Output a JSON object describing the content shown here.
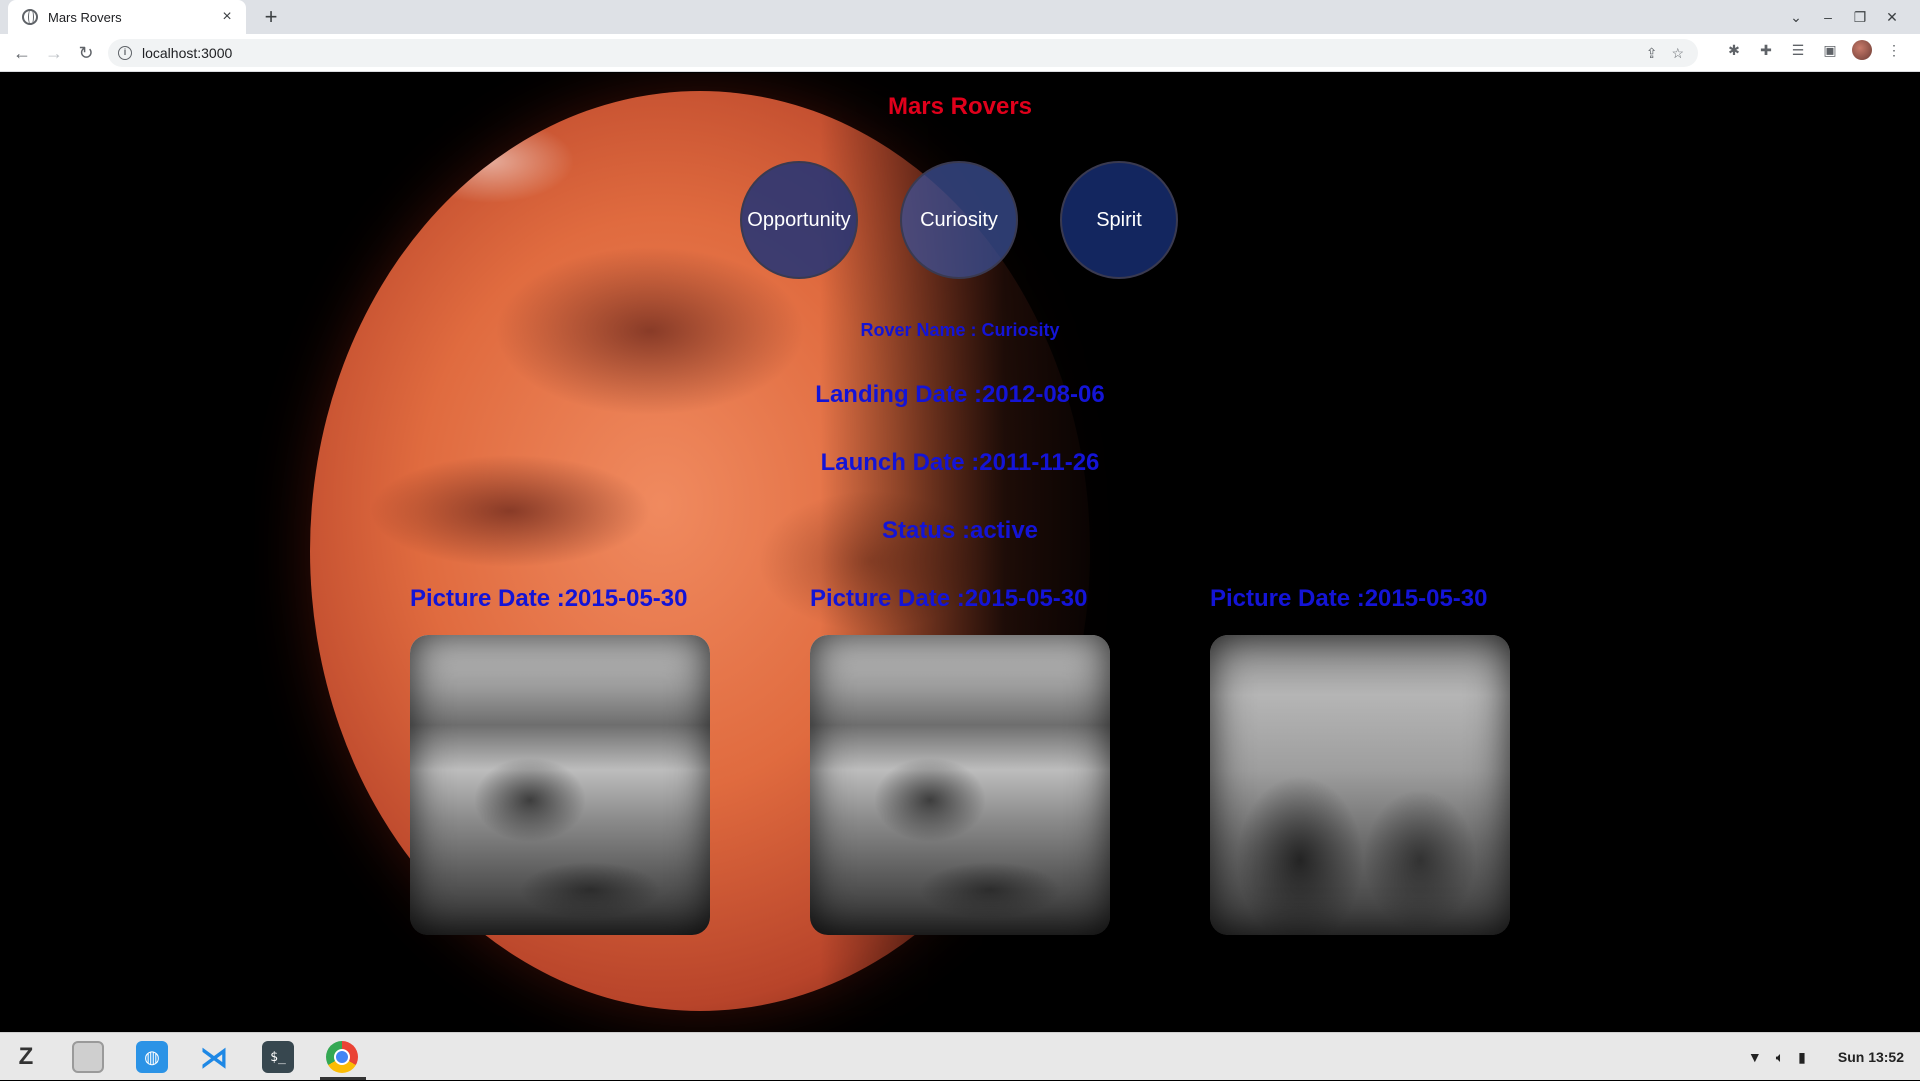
{
  "browser": {
    "tab_title": "Mars Rovers",
    "tab_close": "×",
    "new_tab": "+",
    "url": "localhost:3000",
    "window_controls": [
      "⌄",
      "–",
      "❐",
      "✕"
    ]
  },
  "page": {
    "heading": "Mars Rovers",
    "rovers": [
      "Opportunity",
      "Curiosity",
      "Spirit"
    ],
    "rover_name": "Rover Name : Curiosity",
    "landing_date": "Landing Date :2012-08-06",
    "launch_date": "Launch Date :2011-11-26",
    "status": "Status :active",
    "photos": [
      {
        "date": "Picture Date :2015-05-30"
      },
      {
        "date": "Picture Date :2015-05-30"
      },
      {
        "date": "Picture Date :2015-05-30"
      }
    ]
  },
  "taskbar": {
    "clock": "Sun 13:52"
  },
  "colors": {
    "heading": "#e0001b",
    "info_text": "#1414d6",
    "rover_button": "#203478"
  }
}
